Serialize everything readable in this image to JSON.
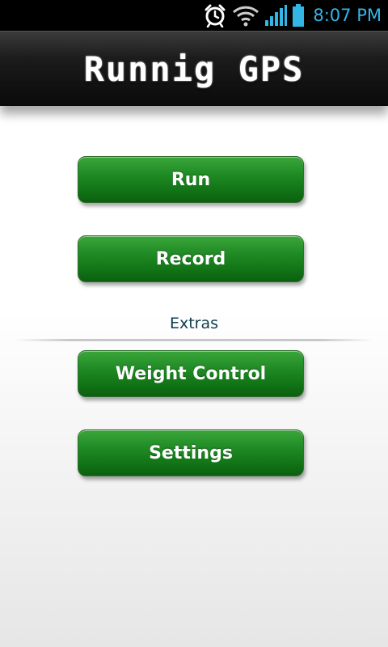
{
  "status_bar": {
    "time": "8:07 PM",
    "icons": [
      "alarm-clock-icon",
      "wifi-icon",
      "signal-icon",
      "battery-icon"
    ],
    "accent_color": "#33b5e5"
  },
  "header": {
    "title": "Runnig GPS"
  },
  "menu": {
    "run_label": "Run",
    "record_label": "Record",
    "extras_label": "Extras",
    "weight_label": "Weight Control",
    "settings_label": "Settings",
    "button_color": "#1a7f1f"
  }
}
